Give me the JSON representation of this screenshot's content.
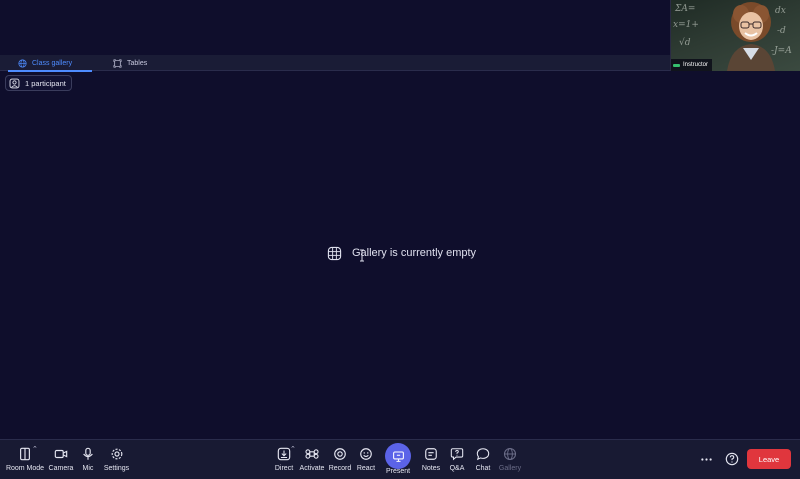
{
  "video": {
    "name": "Instructor",
    "board_text": [
      "ΣA=",
      "x=1+",
      "√d",
      "dx",
      "-d",
      "-J=A"
    ]
  },
  "tabs": [
    {
      "label": "Class gallery",
      "icon": "globe-grid-icon",
      "active": true
    },
    {
      "label": "Tables",
      "icon": "tables-icon",
      "active": false
    }
  ],
  "participants": {
    "label": "1 participant"
  },
  "gallery": {
    "empty_message": "Gallery is currently empty"
  },
  "toolbar": {
    "room_mode": "Room Mode",
    "camera": "Camera",
    "mic": "Mic",
    "settings": "Settings",
    "direct": "Direct",
    "activate": "Activate",
    "record": "Record",
    "react": "React",
    "present": "Present",
    "notes": "Notes",
    "qa": "Q&A",
    "chat": "Chat",
    "gallery": "Gallery",
    "leave": "Leave"
  },
  "colors": {
    "background": "#0f0e2c",
    "accent": "#4e8cff",
    "present": "#5b63e8",
    "leave": "#e0363d"
  }
}
